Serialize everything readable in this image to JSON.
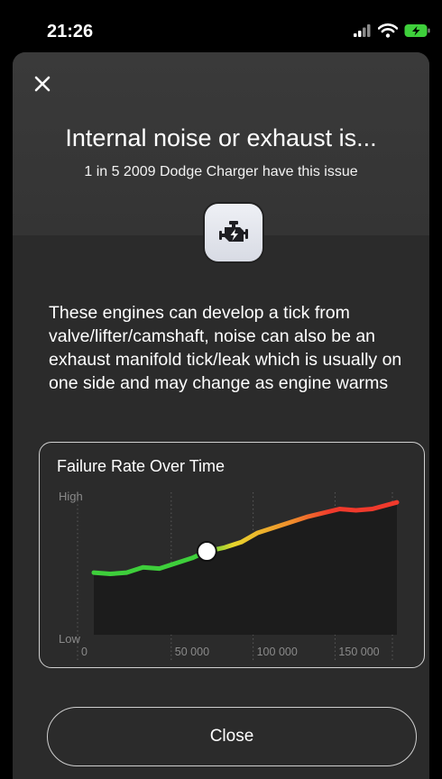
{
  "status_bar": {
    "time": "21:26"
  },
  "sheet": {
    "title": "Internal noise or exhaust is...",
    "subtitle": "1 in 5 2009 Dodge Charger have this issue",
    "description": "These engines can develop a tick from valve/lifter/camshaft, noise can also be an exhaust manifold tick/leak which is usually on one side and may change as engine warms",
    "close_button_label": "Close"
  },
  "chart_data": {
    "type": "area",
    "title": "Failure Rate Over Time",
    "xlabel": "",
    "ylabel": "",
    "y_tick_labels": [
      "High",
      "Low"
    ],
    "x_ticks": [
      0,
      50000,
      100000,
      150000
    ],
    "x_tick_labels": [
      "0",
      "50 000",
      "100 000",
      "150 000"
    ],
    "xlim": [
      0,
      185000
    ],
    "ylim": [
      0,
      1
    ],
    "grid": "vertical dotted",
    "current_marker_x": 69000,
    "series": [
      {
        "x": [
          0,
          10000,
          20000,
          30000,
          40000,
          50000,
          60000,
          69000,
          80000,
          90000,
          100000,
          110000,
          120000,
          130000,
          140000,
          150000,
          160000,
          170000,
          185000
        ],
        "values": [
          0.36,
          0.35,
          0.36,
          0.4,
          0.39,
          0.43,
          0.47,
          0.52,
          0.55,
          0.59,
          0.66,
          0.7,
          0.74,
          0.78,
          0.81,
          0.84,
          0.83,
          0.84,
          0.89
        ]
      }
    ],
    "colors": {
      "low": "#3ecf3b",
      "mid": "#e8d52c",
      "high": "#f03a2c",
      "area": "#1c1c1c",
      "marker": "#ffffff"
    }
  }
}
